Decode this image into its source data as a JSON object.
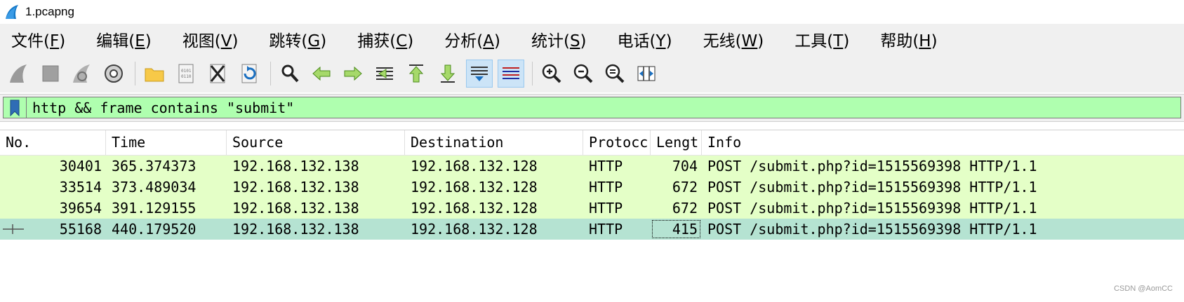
{
  "window": {
    "title": "1.pcapng",
    "app_icon": "wireshark-fin-icon"
  },
  "menu": [
    {
      "label": "文件(",
      "acc": "F",
      "tail": ")"
    },
    {
      "label": "编辑(",
      "acc": "E",
      "tail": ")"
    },
    {
      "label": "视图(",
      "acc": "V",
      "tail": ")"
    },
    {
      "label": "跳转(",
      "acc": "G",
      "tail": ")"
    },
    {
      "label": "捕获(",
      "acc": "C",
      "tail": ")"
    },
    {
      "label": "分析(",
      "acc": "A",
      "tail": ")"
    },
    {
      "label": "统计(",
      "acc": "S",
      "tail": ")"
    },
    {
      "label": "电话(",
      "acc": "Y",
      "tail": ")"
    },
    {
      "label": "无线(",
      "acc": "W",
      "tail": ")"
    },
    {
      "label": "工具(",
      "acc": "T",
      "tail": ")"
    },
    {
      "label": "帮助(",
      "acc": "H",
      "tail": ")"
    }
  ],
  "toolbar_icons": [
    "start-capture-icon",
    "stop-capture-icon",
    "restart-capture-icon",
    "capture-options-icon",
    "open-file-icon",
    "save-file-icon",
    "close-file-icon",
    "reload-file-icon",
    "find-packet-icon",
    "go-back-icon",
    "go-forward-icon",
    "go-to-packet-icon",
    "first-packet-icon",
    "last-packet-icon",
    "auto-scroll-icon",
    "colorize-icon",
    "zoom-in-icon",
    "zoom-out-icon",
    "zoom-reset-icon",
    "resize-columns-icon"
  ],
  "filter": {
    "value": "http && frame contains \"submit\"",
    "bookmark_icon": "bookmark-icon",
    "color": "#afffaf"
  },
  "columns": [
    "No.",
    "Time",
    "Source",
    "Destination",
    "Protocc",
    "Lengt",
    "Info"
  ],
  "packets": [
    {
      "no": "30401",
      "time": "365.374373",
      "src": "192.168.132.138",
      "dst": "192.168.132.128",
      "proto": "HTTP",
      "len": "704",
      "info": "POST /submit.php?id=1515569398 HTTP/1.1"
    },
    {
      "no": "33514",
      "time": "373.489034",
      "src": "192.168.132.138",
      "dst": "192.168.132.128",
      "proto": "HTTP",
      "len": "672",
      "info": "POST /submit.php?id=1515569398 HTTP/1.1"
    },
    {
      "no": "39654",
      "time": "391.129155",
      "src": "192.168.132.138",
      "dst": "192.168.132.128",
      "proto": "HTTP",
      "len": "672",
      "info": "POST /submit.php?id=1515569398 HTTP/1.1"
    },
    {
      "no": "55168",
      "time": "440.179520",
      "src": "192.168.132.138",
      "dst": "192.168.132.128",
      "proto": "HTTP",
      "len": "415",
      "info": "POST /submit.php?id=1515569398 HTTP/1.1"
    }
  ],
  "selected_packet_index": 3,
  "colors": {
    "http_row": "#e4ffc7",
    "selected_row": "#b5e3d2",
    "toolbar_bg": "#f0f0f0"
  },
  "watermark": "CSDN @AomCC"
}
